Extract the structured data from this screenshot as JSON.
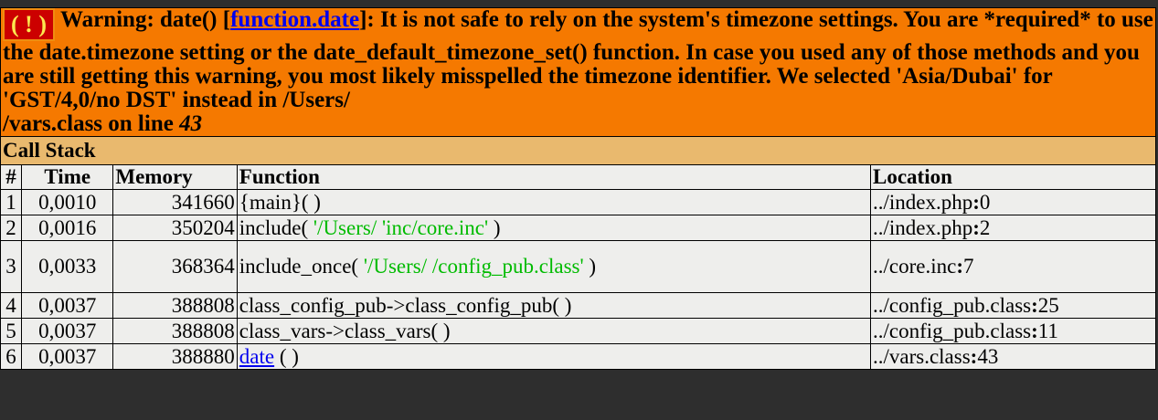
{
  "warning": {
    "icon": "( ! )",
    "prefix": "Warning: date() [",
    "link_text": "function.date",
    "message": "]: It is not safe to rely on the system's timezone settings. You are *required* to use the date.timezone setting or the date_default_timezone_set() function. In case you used any of those methods and you are still getting this warning, you most likely misspelled the timezone identifier. We selected 'Asia/Dubai' for 'GST/4,0/no DST' instead in /Users/",
    "path_tail": "/vars.class on line ",
    "line_number": "43"
  },
  "callstack": {
    "title": "Call Stack",
    "headers": [
      "#",
      "Time",
      "Memory",
      "Function",
      "Location"
    ],
    "rows": [
      {
        "num": "1",
        "time": "0,0010",
        "memory": "341660",
        "fn": "{main}( )",
        "param": "",
        "fn_close": "",
        "loc_file": "../index.php",
        "loc_sep": ":",
        "loc_line": "0"
      },
      {
        "num": "2",
        "time": "0,0016",
        "memory": "350204",
        "fn": "include( ",
        "param": "'/Users/ 'inc/core.inc'",
        "fn_close": " )",
        "loc_file": "../index.php",
        "loc_sep": ":",
        "loc_line": "2"
      },
      {
        "num": "3",
        "time": "0,0033",
        "memory": "368364",
        "fn": "include_once( ",
        "param": "'/Users/ /config_pub.class'",
        "fn_close": " )",
        "loc_file": "../core.inc",
        "loc_sep": ":",
        "loc_line": "7"
      },
      {
        "num": "4",
        "time": "0,0037",
        "memory": "388808",
        "fn": "class_config_pub->class_config_pub( )",
        "param": "",
        "fn_close": "",
        "loc_file": "../config_pub.class",
        "loc_sep": ":",
        "loc_line": "25"
      },
      {
        "num": "5",
        "time": "0,0037",
        "memory": "388808",
        "fn": "class_vars->class_vars( )",
        "param": "",
        "fn_close": "",
        "loc_file": "../config_pub.class",
        "loc_sep": ":",
        "loc_line": "11"
      },
      {
        "num": "6",
        "time": "0,0037",
        "memory": "388880",
        "fn_link": "date",
        "fn": " ( )",
        "param": "",
        "fn_close": "",
        "loc_file": "../vars.class",
        "loc_sep": ":",
        "loc_line": "43"
      }
    ]
  },
  "colors": {
    "warning_bg": "#f57900",
    "callstack_bg": "#e9b96e",
    "row_bg": "#eeeeec",
    "param_color": "#00bb00",
    "link_color": "#0000ee"
  }
}
